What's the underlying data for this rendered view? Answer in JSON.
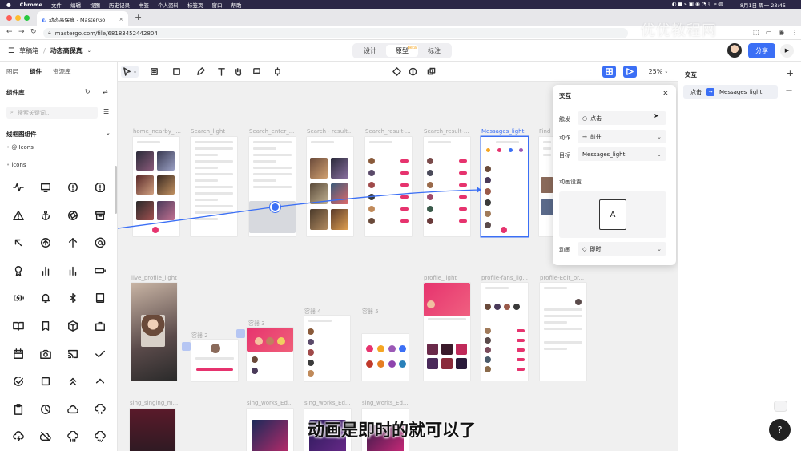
{
  "menubar": {
    "app": "Chrome",
    "items": [
      "文件",
      "编辑",
      "视图",
      "历史记录",
      "书签",
      "个人资料",
      "标签页",
      "窗口",
      "帮助"
    ],
    "clock": "8月1日 周一 23:45"
  },
  "browser": {
    "tab_title": "动态高保真 - MasterGo",
    "url": "mastergo.com/file/68183452442804"
  },
  "watermark": "优优教程网",
  "app": {
    "breadcrumb_root": "草稿箱",
    "breadcrumb_file": "动态高保真",
    "modes": [
      "设计",
      "原型",
      "标注"
    ],
    "active_mode": "原型",
    "beta_tag": "beta",
    "share_label": "分享",
    "zoom": "25%"
  },
  "leftpanel": {
    "tabs": [
      "图层",
      "组件",
      "资源库"
    ],
    "active_tab": "组件",
    "library_title": "组件库",
    "search_placeholder": "搜索关键词...",
    "group_title": "线框图组件",
    "tree_items": [
      "@ Icons",
      "icons"
    ]
  },
  "icons": [
    "activity-icon",
    "cast-icon",
    "alert-circle-icon",
    "alert-octagon-icon",
    "alert-triangle-icon",
    "anchor-icon",
    "aperture-icon",
    "archive-icon",
    "arrow-up-left-icon",
    "arrow-up-circle-icon",
    "arrow-up-icon",
    "at-sign-icon",
    "award-icon",
    "bar-chart-icon",
    "bar-chart-2-icon",
    "battery-icon",
    "battery-charging-icon",
    "bell-icon",
    "bluetooth-icon",
    "book-icon",
    "book-open-icon",
    "bookmark-icon",
    "box-icon",
    "briefcase-icon",
    "calendar-icon",
    "camera-icon",
    "cast-screen-icon",
    "check-icon",
    "check-circle-icon",
    "square-icon",
    "chevrons-up-icon",
    "chevron-up-icon",
    "clipboard-icon",
    "clock-icon",
    "cloud-icon",
    "cloud-drizzle-icon",
    "cloud-lightning-icon",
    "cloud-off-icon",
    "cloud-rain-icon",
    "cloud-snow-icon"
  ],
  "frames": {
    "labels": [
      "home_nearby_l...",
      "Search_light",
      "Search_enter_...",
      "Search - result...",
      "Search_result-...",
      "Search_result-...",
      "Messages_light",
      "Find",
      "live_profile_light",
      "容器 2",
      "容器 3",
      "容器 4",
      "容器 5",
      "profile_light",
      "profile-fans_lig...",
      "profile-Edit_pr...",
      "sing_singing_m...",
      "sing_works_Ed...",
      "sing_works_Ed...",
      "sing_works_Ed..."
    ]
  },
  "subtitle": "动画是即时的就可以了",
  "popover": {
    "title": "交互",
    "trigger_label": "触发",
    "trigger_value": "点击",
    "action_label": "动作",
    "action_value": "前往",
    "target_label": "目标",
    "target_value": "Messages_light",
    "anim_settings_label": "动画设置",
    "anim_preview_letter": "A",
    "anim_label": "动画",
    "anim_value": "即时"
  },
  "rightpanel": {
    "title": "交互",
    "item_trigger": "点击",
    "item_target": "Messages_light"
  },
  "colors": {
    "accent": "#3b6ff5",
    "brand_pink": "#e6336e",
    "menubar": "#2b2746"
  }
}
